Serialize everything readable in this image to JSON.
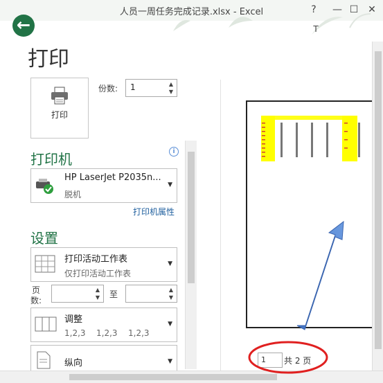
{
  "window": {
    "title": "人员一周任务完成记录.xlsx - Excel",
    "help": "?",
    "minimize": "—",
    "maximize": "☐",
    "close": "✕",
    "user_initial": "T"
  },
  "back": "←",
  "page_title": "打印",
  "print_button": "打印",
  "copies": {
    "label": "份数:",
    "value": "1"
  },
  "printer": {
    "heading": "打印机",
    "info": "i",
    "name": "HP LaserJet P2035n...",
    "status": "脱机",
    "properties_link": "打印机属性"
  },
  "settings": {
    "heading": "设置",
    "scope": {
      "title": "打印活动工作表",
      "subtitle": "仅打印活动工作表"
    },
    "pages": {
      "label_line1": "页",
      "label_line2": "数:",
      "to": "至",
      "from_value": "",
      "to_value": ""
    },
    "collate": {
      "title": "调整",
      "items": [
        "1,2,3",
        "1,2,3",
        "1,2,3"
      ]
    },
    "orientation": {
      "title": "纵向"
    }
  },
  "pager": {
    "current": "1",
    "total_text": "共 2 页"
  },
  "colors": {
    "accent": "#217346",
    "highlight": "#ffff00",
    "arrow": "#4472c4",
    "annotation": "#e02020"
  }
}
